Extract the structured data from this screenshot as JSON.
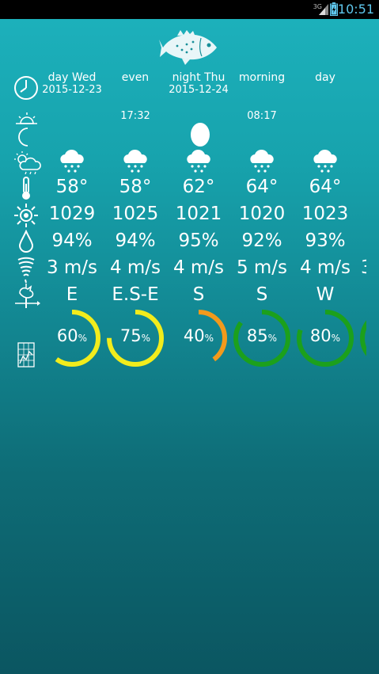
{
  "status_bar": {
    "time": "10:51",
    "network": "3G"
  },
  "header": [
    {
      "top": "day Wed",
      "bottom": "2015-12-23"
    },
    {
      "top": "even",
      "bottom": ""
    },
    {
      "top": "night Thu",
      "bottom": "2015-12-24"
    },
    {
      "top": "morning",
      "bottom": ""
    },
    {
      "top": "day",
      "bottom": ""
    }
  ],
  "events": {
    "sunset": "17:32",
    "sunrise": "08:17"
  },
  "temperatures": [
    "58°",
    "58°",
    "62°",
    "64°",
    "64°"
  ],
  "pressures": [
    "1029",
    "1025",
    "1021",
    "1020",
    "1023"
  ],
  "humidity": [
    "94%",
    "94%",
    "95%",
    "92%",
    "93%"
  ],
  "wind_speeds": [
    "3 m/s",
    "4 m/s",
    "4 m/s",
    "5 m/s",
    "4 m/s"
  ],
  "wind_speed_partial": "3",
  "wind_directions": [
    "E",
    "E.S-E",
    "S",
    "S",
    "W"
  ],
  "bite": {
    "values": [
      60,
      75,
      40,
      85,
      80
    ],
    "labels": [
      "60",
      "75",
      "40",
      "85",
      "80"
    ],
    "unit": "%",
    "colors": [
      "#f2ec1c",
      "#f2ec1c",
      "#f29a1c",
      "#1ca01c",
      "#1ca01c"
    ],
    "partial_color": "#1ca01c"
  },
  "icons": {
    "clock": "clock-icon",
    "sun_moon": "sunrise-sunset-icon",
    "weather": "weather-icon",
    "temperature": "thermometer-icon",
    "pressure": "pressure-icon",
    "humidity": "droplet-icon",
    "wind": "tornado-icon",
    "direction": "weathervane-icon",
    "chart": "chart-icon"
  }
}
